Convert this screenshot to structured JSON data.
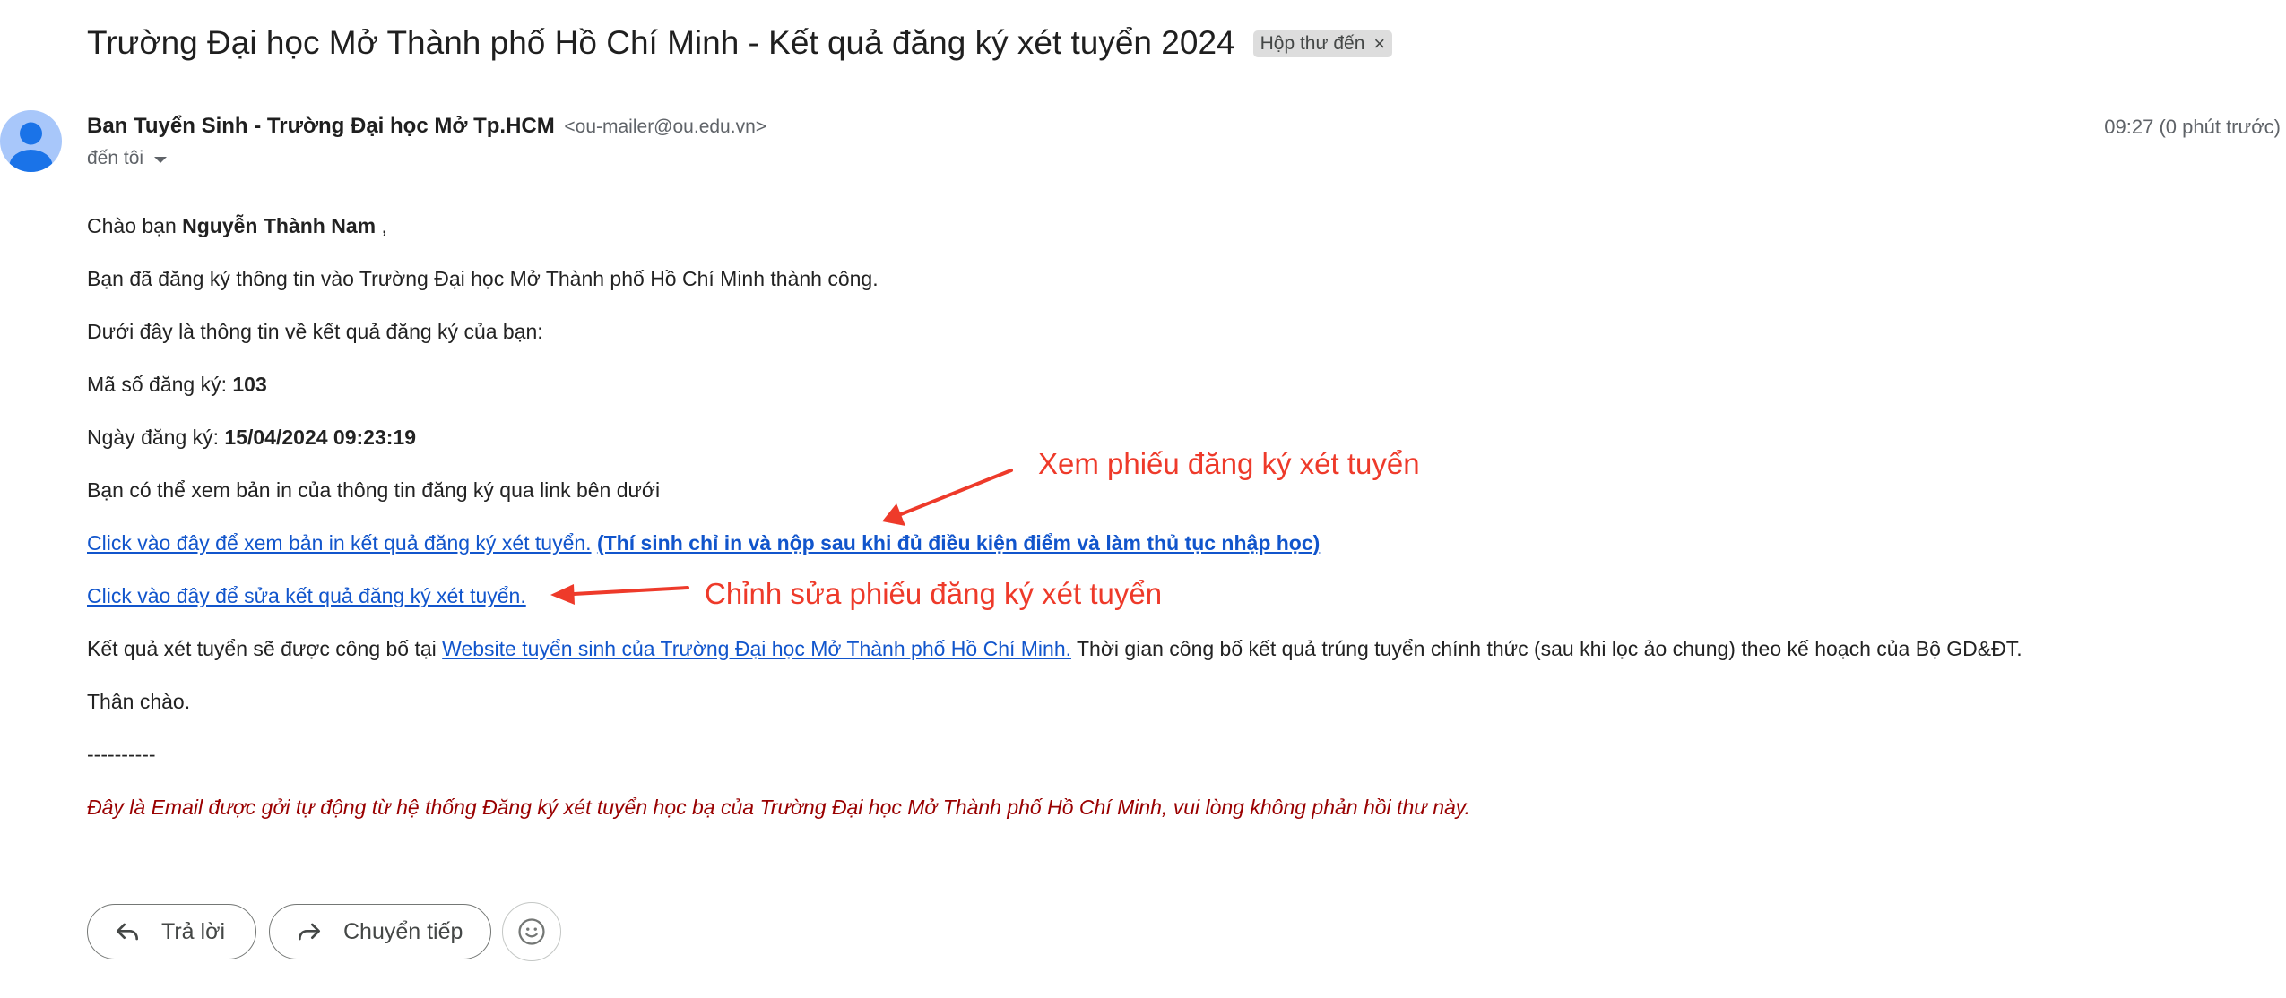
{
  "email": {
    "subject": "Trường Đại học Mở Thành phố Hồ Chí Minh - Kết quả đăng ký xét tuyển 2024",
    "label_chip": "Hộp thư đến",
    "label_chip_remove": "×",
    "sender_name": "Ban Tuyển Sinh - Trường Đại học Mở Tp.HCM",
    "sender_email": "<ou-mailer@ou.edu.vn>",
    "timestamp": "09:27 (0 phút trước)",
    "to_text": "đến tôi"
  },
  "body": {
    "greeting_prefix": "Chào bạn ",
    "greeting_name": "Nguyễn Thành Nam",
    "greeting_suffix": " ,",
    "line_registered": "Bạn đã đăng ký thông tin vào Trường Đại học Mở Thành phố Hồ Chí Minh thành công.",
    "line_info_intro": "Dưới đây là thông tin về kết quả đăng ký của bạn:",
    "reg_code_label": "Mã số đăng ký: ",
    "reg_code_value": "103",
    "reg_date_label": "Ngày đăng ký: ",
    "reg_date_value": "15/04/2024 09:23:19",
    "line_print_intro": "Bạn có thể xem bản in của thông tin đăng ký qua link bên dưới",
    "link_view_print": "Click vào đây để xem bản in kết quả đăng ký xét tuyển.",
    "link_view_print_note": "(Thí sinh chỉ in và nộp sau khi đủ điều kiện điểm và làm thủ tục nhập học)",
    "link_edit": "Click vào đây để sửa kết quả đăng ký xét tuyển.",
    "result_prefix": "Kết quả xét tuyển sẽ được công bố tại ",
    "result_link": "Website tuyển sinh của Trường Đại học Mở Thành phố Hồ Chí Minh.",
    "result_suffix": " Thời gian công bố kết quả trúng tuyển chính thức (sau khi lọc ảo chung) theo kế hoạch của Bộ GD&ĐT.",
    "closing": "Thân chào.",
    "separator": "----------",
    "footer_note": "Đây là Email được gởi tự động từ hệ thống Đăng ký xét tuyển học bạ của Trường Đại học Mở Thành phố Hồ Chí Minh, vui lòng không phản hồi thư này."
  },
  "annotations": {
    "view_form": "Xem phiếu đăng ký xét tuyển",
    "edit_form": "Chỉnh sửa phiếu đăng ký xét tuyển",
    "color": "#ee3a2a"
  },
  "actions": {
    "reply_label": "Trả lời",
    "forward_label": "Chuyển tiếp",
    "reply_icon": "reply-icon",
    "forward_icon": "forward-icon",
    "emoji_icon": "emoji-icon"
  },
  "colors": {
    "link": "#1155cc",
    "footer_note": "#990000",
    "avatar_bg": "#a8c7fa",
    "avatar_fg": "#1a73e8"
  }
}
